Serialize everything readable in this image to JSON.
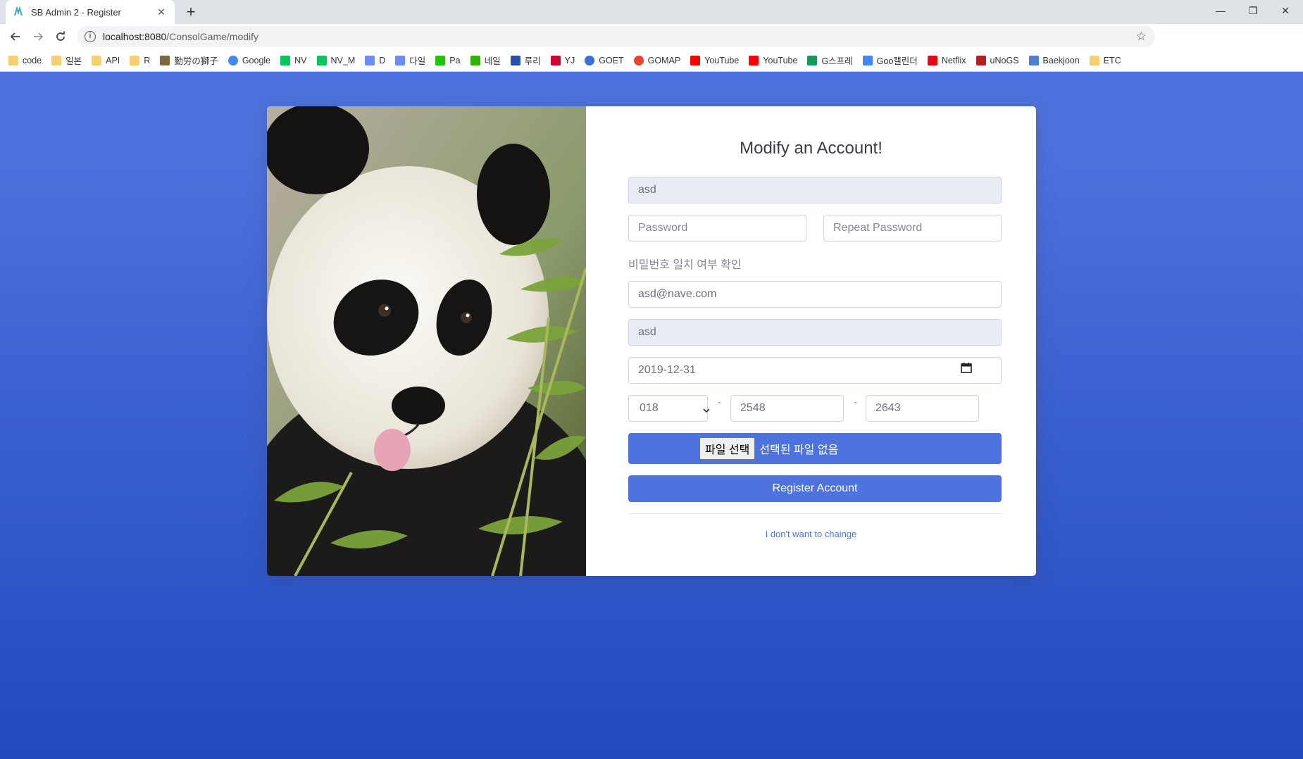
{
  "browser": {
    "tab_title": "SB Admin 2 - Register",
    "url_host": "localhost:8080",
    "url_path": "/ConsolGame/modify",
    "bookmarks": [
      {
        "label": "code",
        "icon": "folder"
      },
      {
        "label": "일본",
        "icon": "folder"
      },
      {
        "label": "API",
        "icon": "folder"
      },
      {
        "label": "R",
        "icon": "folder"
      },
      {
        "label": "勤労の獅子",
        "icon": "flower"
      },
      {
        "label": "Google",
        "icon": "google"
      },
      {
        "label": "NV",
        "icon": "naver"
      },
      {
        "label": "NV_M",
        "icon": "naver"
      },
      {
        "label": "D",
        "icon": "daum"
      },
      {
        "label": "다일",
        "icon": "daum"
      },
      {
        "label": "Pa",
        "icon": "papago"
      },
      {
        "label": "네일",
        "icon": "green-square"
      },
      {
        "label": "루리",
        "icon": "cube"
      },
      {
        "label": "YJ",
        "icon": "yahoo"
      },
      {
        "label": "GOET",
        "icon": "globe"
      },
      {
        "label": "GOMAP",
        "icon": "map-pin"
      },
      {
        "label": "YouTube",
        "icon": "youtube"
      },
      {
        "label": "YouTube",
        "icon": "youtube"
      },
      {
        "label": "G스프레",
        "icon": "sheets"
      },
      {
        "label": "Goo캘린더",
        "icon": "calendar"
      },
      {
        "label": "Netflix",
        "icon": "netflix"
      },
      {
        "label": "uNoGS",
        "icon": "unogs"
      },
      {
        "label": "Baekjoon",
        "icon": "code"
      },
      {
        "label": "ETC",
        "icon": "folder"
      }
    ],
    "colors": {
      "folder": "#f6d06a",
      "youtube": "#ff0000",
      "netflix": "#e50914",
      "naver": "#03c75a"
    }
  },
  "form": {
    "heading": "Modify an Account!",
    "user_id": "asd",
    "password_placeholder": "Password",
    "repeat_password_placeholder": "Repeat Password",
    "password_hint": "비밀번호 일치 여부 확인",
    "email": "asd@nave.com",
    "name": "asd",
    "birthdate": "2019-12-31",
    "phone_prefix": "018",
    "phone_middle": "2548",
    "phone_last": "2643",
    "phone_dash": "-",
    "file_button": "파일 선택",
    "file_status": "선택된 파일 없음",
    "submit_label": "Register Account",
    "cancel_link": "I don't want to chainge"
  },
  "theme": {
    "primary": "#4e73df",
    "primary_dark": "#224abe"
  }
}
